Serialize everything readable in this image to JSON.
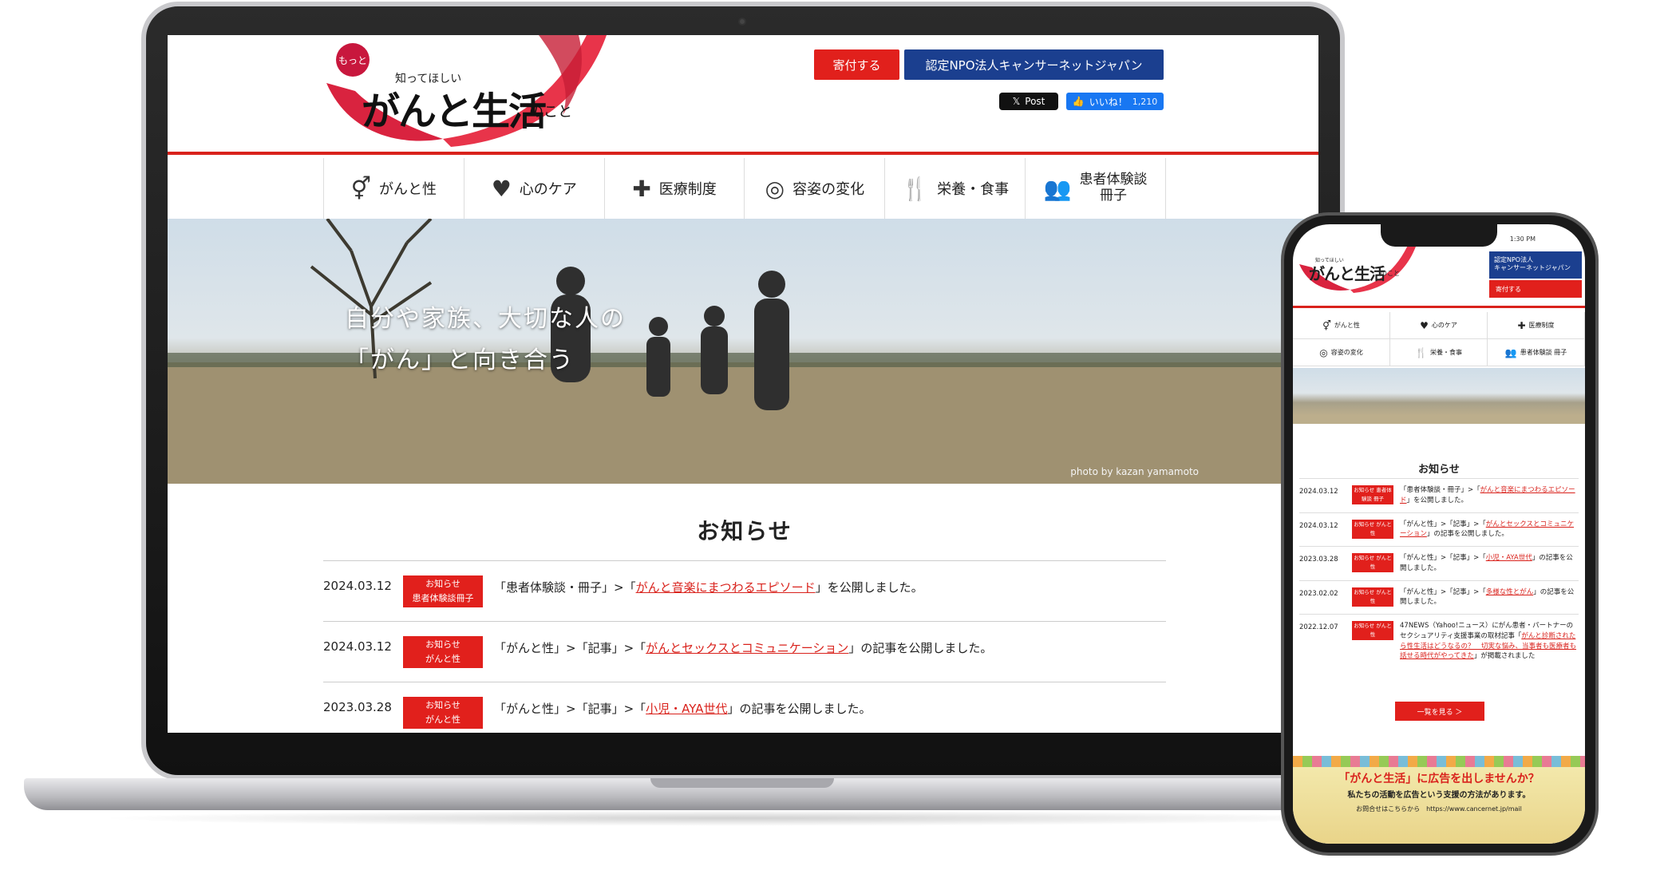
{
  "site": {
    "logo_motto": "もっと",
    "logo_small": "知ってほしい",
    "logo_main": "がんと生活",
    "logo_tail": "のこと",
    "donate_label": "寄付する",
    "npo_label": "認定NPO法人キャンサーネットジャパン",
    "post_label": "Post",
    "like_label": "いいね！",
    "like_count": "1,210"
  },
  "nav": [
    {
      "icon": "gender-icon",
      "glyph": "⚥",
      "label": "がんと性"
    },
    {
      "icon": "heart-icon",
      "glyph": "♥",
      "label": "心のケア"
    },
    {
      "icon": "medical-bag-icon",
      "glyph": "✚",
      "label": "医療制度"
    },
    {
      "icon": "appearance-icon",
      "glyph": "◎",
      "label": "容姿の変化"
    },
    {
      "icon": "fork-knife-icon",
      "glyph": "🍴",
      "label": "栄養・食事"
    },
    {
      "icon": "group-icon",
      "glyph": "👥",
      "label1": "患者体験談",
      "label2": "冊子"
    }
  ],
  "hero": {
    "line1": "自分や家族、大切な人の",
    "line2": "「がん」と向き合う",
    "credit": "photo by kazan yamamoto"
  },
  "news": {
    "title": "お知らせ",
    "items": [
      {
        "date": "2024.03.12",
        "badge1": "お知らせ",
        "badge2": "患者体験談冊子",
        "pre": "「患者体験談・冊子」>「",
        "link": "がんと音楽にまつわるエピソード",
        "post": "」を公開しました。"
      },
      {
        "date": "2024.03.12",
        "badge1": "お知らせ",
        "badge2": "がんと性",
        "pre": "「がんと性」>「記事」>「",
        "link": "がんとセックスとコミュニケーション",
        "post": "」の記事を公開しました。"
      },
      {
        "date": "2023.03.28",
        "badge1": "お知らせ",
        "badge2": "がんと性",
        "pre": "「がんと性」>「記事」>「",
        "link": "小児・AYA世代",
        "post": "」の記事を公開しました。"
      }
    ]
  },
  "phone": {
    "time": "1:30 PM",
    "npo_line1": "認定NPO法人",
    "npo_line2": "キャンサーネットジャパン",
    "donate_label": "寄付する",
    "nav": [
      {
        "icon": "gender-icon",
        "glyph": "⚥",
        "label": "がんと性"
      },
      {
        "icon": "heart-icon",
        "glyph": "♥",
        "label": "心のケア"
      },
      {
        "icon": "medical-bag-icon",
        "glyph": "✚",
        "label": "医療制度"
      },
      {
        "icon": "appearance-icon",
        "glyph": "◎",
        "label": "容姿の変化"
      },
      {
        "icon": "fork-knife-icon",
        "glyph": "🍴",
        "label": "栄養・食事"
      },
      {
        "icon": "group-icon",
        "glyph": "👥",
        "label": "患者体験談 冊子"
      }
    ],
    "news_title": "お知らせ",
    "items": [
      {
        "date": "2024.03.12",
        "badge": "お知らせ 患者体験談 冊子",
        "pre": "「患者体験談・冊子」>「",
        "link": "がんと音楽にまつわるエピソード",
        "post": "」を公開しました。"
      },
      {
        "date": "2024.03.12",
        "badge": "お知らせ がんと性",
        "pre": "「がんと性」>「記事」>「",
        "link": "がんとセックスとコミュニケーション",
        "post": "」の記事を公開しました。"
      },
      {
        "date": "2023.03.28",
        "badge": "お知らせ がんと性",
        "pre": "「がんと性」>「記事」>「",
        "link": "小児・AYA世代",
        "post": "」の記事を公開しました。"
      },
      {
        "date": "2023.02.02",
        "badge": "お知らせ がんと性",
        "pre": "「がんと性」>「記事」>「",
        "link": "多様な性とがん",
        "post": "」の記事を公開しました。"
      },
      {
        "date": "2022.12.07",
        "badge": "お知らせ がんと性",
        "pre": "47NEWS（Yahoo!ニュース）にがん患者・パートナーのセクシュアリティ支援事業の取材記事「",
        "link": "がんと診断されたら性生活はどうなるの？　切実な悩み、当事者も医療者も話せる時代がやってきた",
        "post": "」が掲載されました"
      }
    ],
    "more_label": "一覧を見る ＞",
    "ad_heading": "「がんと生活」に広告を出しませんか？",
    "ad_sub": "私たちの活動を広告という支援の方法があります。",
    "ad_contact": "お問合せはこちらから　https://www.cancernet.jp/mail"
  }
}
